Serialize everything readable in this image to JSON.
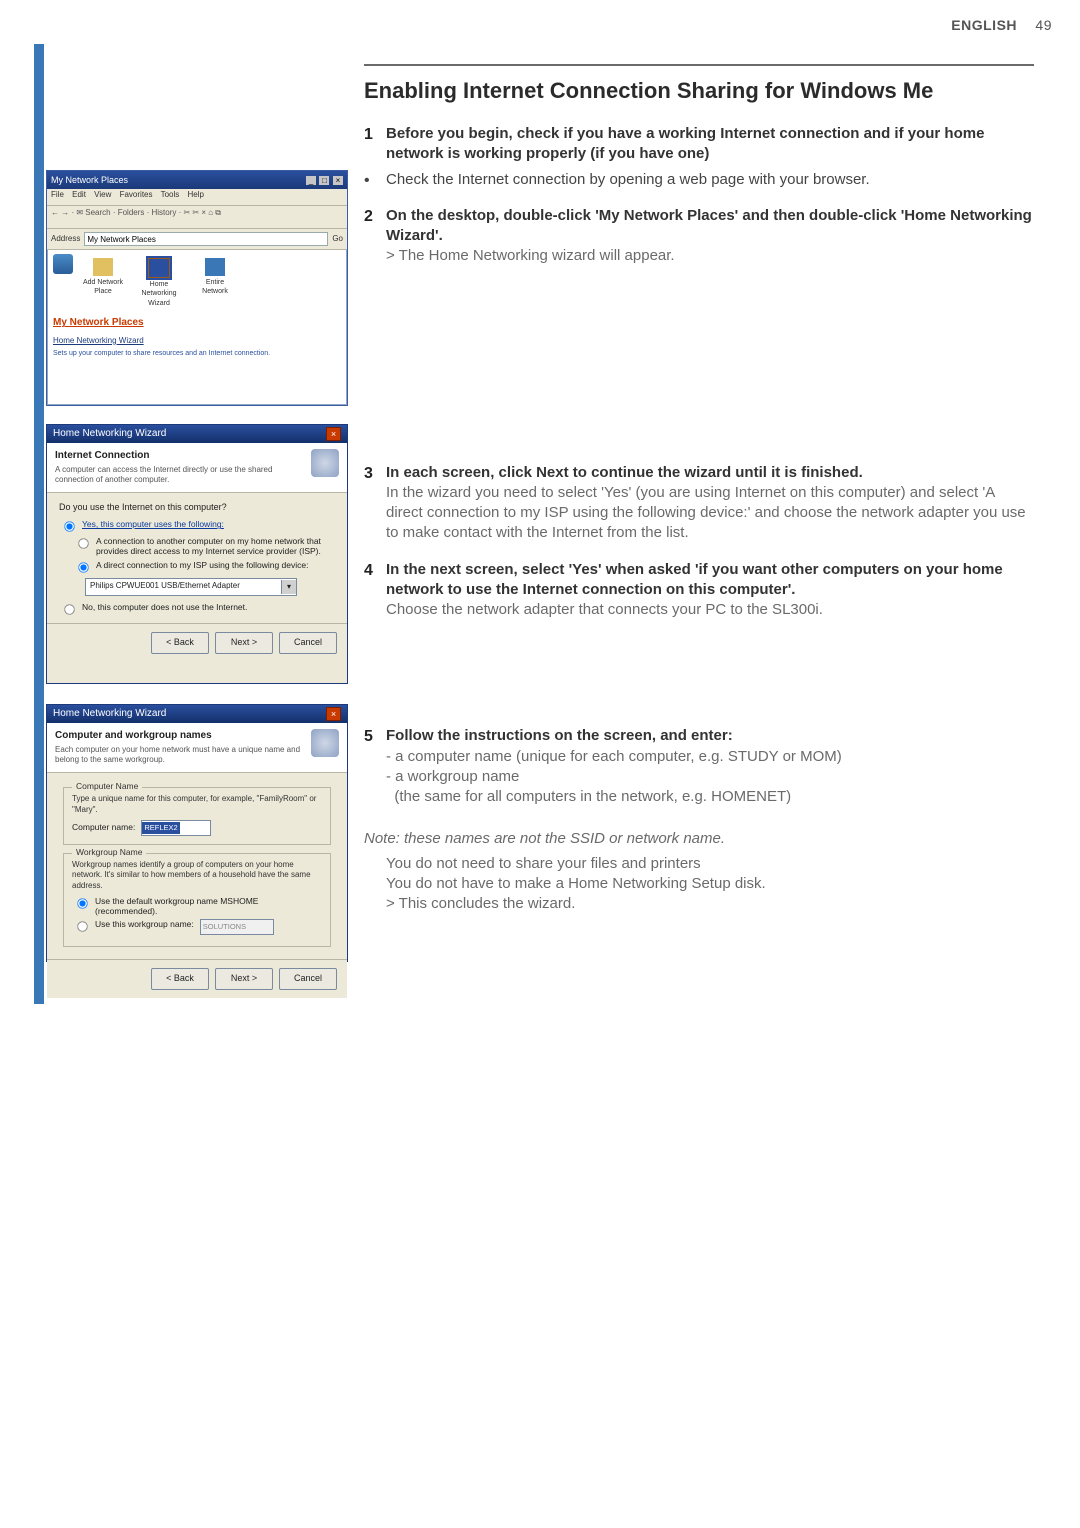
{
  "header": {
    "language": "ENGLISH",
    "page_number": "49"
  },
  "title": "Enabling Internet Connection Sharing for Windows Me",
  "steps": {
    "s1": {
      "num": "1",
      "bold": "Before you begin, check if you have a working Internet connection and if your home network is working properly (if you have one)",
      "bullet": "Check the Internet connection by opening a web page with your browser."
    },
    "s2": {
      "num": "2",
      "bold": "On the desktop, double-click 'My Network Places' and then double-click 'Home Networking Wizard'.",
      "gray": "> The Home Networking wizard will appear."
    },
    "s3": {
      "num": "3",
      "bold": "In each screen, click Next to continue the wizard until it is finished.",
      "gray": "In the wizard you need to select 'Yes' (you are using Internet on this computer) and select 'A direct connection to my ISP using the following device:' and choose the network adapter you use to make contact with the Internet from the list."
    },
    "s4": {
      "num": "4",
      "bold": "In the next screen, select 'Yes' when asked 'if you want other computers on your home network to use the Internet connection on this computer'.",
      "gray": "Choose the network adapter that connects your PC to the SL300i."
    },
    "s5": {
      "num": "5",
      "bold": "Follow the instructions on the screen, and enter:",
      "line1": "- a computer name (unique for each computer, e.g. STUDY or MOM)",
      "line2": "- a workgroup name",
      "line3": "  (the same for all computers in the network, e.g. HOMENET)"
    }
  },
  "note": {
    "italic": "Note: these names are not the SSID or network name.",
    "line1": "You do not need to share your files and printers",
    "line2": "You do not have to make a Home Networking Setup disk.",
    "line3": "> This concludes the wizard."
  },
  "shot1": {
    "title": "My Network Places",
    "menu": {
      "file": "File",
      "edit": "Edit",
      "view": "View",
      "favorites": "Favorites",
      "tools": "Tools",
      "help": "Help"
    },
    "addr_label": "Address",
    "addr_value": "My Network Places",
    "go": "Go",
    "icons": {
      "a": "Add Network Place",
      "b": "Home Networking Wizard",
      "c": "Entire Network"
    },
    "heading": "My Network Places",
    "sub": "Home Networking Wizard",
    "tiny": "Sets up your computer to share resources and an Internet connection."
  },
  "wiz2": {
    "title": "Home Networking Wizard",
    "header_title": "Internet Connection",
    "header_sub": "A computer can access the Internet directly or use the shared connection of another computer.",
    "question": "Do you use the Internet on this computer?",
    "yes_label": "Yes, this computer uses the following:",
    "opt_a": "A connection to another computer on my home network that provides direct access to my Internet service provider (ISP).",
    "opt_b": "A direct connection to my ISP using the following device:",
    "combo_value": "Philips CPWUE001 USB/Ethernet Adapter",
    "no_label": "No, this computer does not use the Internet.",
    "back": "< Back",
    "next": "Next >",
    "cancel": "Cancel"
  },
  "wiz3": {
    "title": "Home Networking Wizard",
    "header_title": "Computer and workgroup names",
    "header_sub": "Each computer on your home network must have a unique name and belong to the same workgroup.",
    "cn_legend": "Computer Name",
    "cn_hint": "Type a unique name for this computer, for example, \"FamilyRoom\" or \"Mary\".",
    "cn_label": "Computer name:",
    "cn_value": "REFLEX2",
    "wg_legend": "Workgroup Name",
    "wg_hint": "Workgroup names identify a group of computers on your home network. It's similar to how members of a household have the same address.",
    "wg_opt_default": "Use the default workgroup name MSHOME (recommended).",
    "wg_opt_custom": "Use this workgroup name:",
    "wg_value": "SOLUTIONS",
    "back": "< Back",
    "next": "Next >",
    "cancel": "Cancel"
  }
}
